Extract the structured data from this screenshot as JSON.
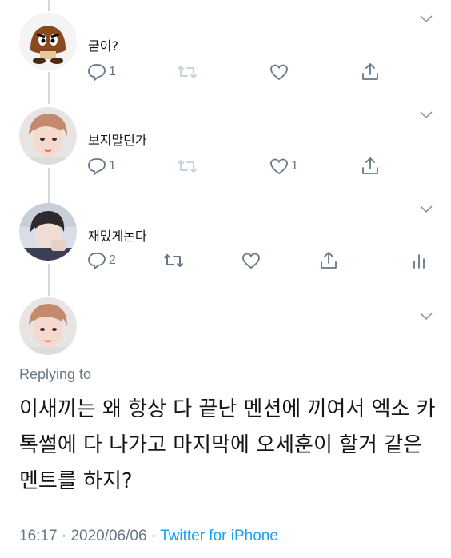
{
  "replies": [
    {
      "avatar": "goomba-avatar",
      "text": "굳이?",
      "reply_count": "1",
      "retweet_count": "",
      "like_count": ""
    },
    {
      "avatar": "user-avatar",
      "text": "보지말던가",
      "reply_count": "1",
      "retweet_count": "",
      "like_count": "1"
    },
    {
      "avatar": "user-avatar",
      "text": "재밌게논다",
      "reply_count": "2",
      "retweet_count": "",
      "like_count": ""
    }
  ],
  "main_tweet": {
    "replying_to": "Replying to",
    "text": "이새끼는 왜 항상 다 끝난 멘션에 끼여서 엑소 카톡썰에 다 나가고 마지막에 오세훈이 할거 같은 멘트를 하지?",
    "time": "16:17",
    "date": "2020/06/06",
    "separator": " · ",
    "source": "Twitter for iPhone"
  },
  "colors": {
    "muted": "#657786",
    "link": "#1da1f2",
    "line": "#cfd9de",
    "retweet_faded": "#c9d3da"
  }
}
